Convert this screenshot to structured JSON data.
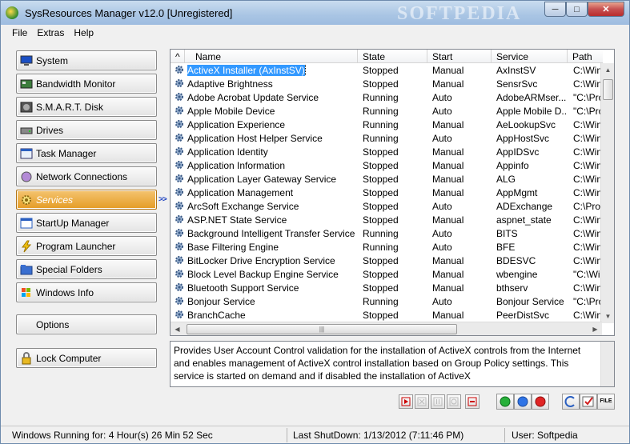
{
  "window": {
    "title": "SysResources Manager  v12.0 [Unregistered]",
    "watermark": "SOFTPEDIA",
    "controls": [
      "minimize",
      "maximize",
      "close"
    ]
  },
  "menu": [
    "File",
    "Extras",
    "Help"
  ],
  "sidebar": {
    "items": [
      {
        "label": "System",
        "icon": "monitor-icon"
      },
      {
        "label": "Bandwidth Monitor",
        "icon": "network-card-icon"
      },
      {
        "label": "S.M.A.R.T. Disk",
        "icon": "disk-icon"
      },
      {
        "label": "Drives",
        "icon": "drive-icon"
      },
      {
        "label": "Task Manager",
        "icon": "task-icon"
      },
      {
        "label": "Network Connections",
        "icon": "globe-icon"
      },
      {
        "label": "Services",
        "icon": "gear-icon",
        "active": true
      },
      {
        "label": "StartUp Manager",
        "icon": "startup-icon"
      },
      {
        "label": "Program Launcher",
        "icon": "lightning-icon"
      },
      {
        "label": "Special Folders",
        "icon": "folder-icon"
      },
      {
        "label": "Windows Info",
        "icon": "windows-logo-icon"
      }
    ],
    "options_label": "Options",
    "lock_label": "Lock Computer",
    "active_arrow": ">>"
  },
  "table": {
    "columns": [
      "Name",
      "State",
      "Start",
      "Service",
      "Path"
    ],
    "sort_indicator": "^",
    "rows": [
      {
        "name": "ActiveX Installer (AxInstSV)",
        "state": "Stopped",
        "start": "Manual",
        "service": "AxInstSV",
        "path": "C:\\Wind",
        "selected": true
      },
      {
        "name": "Adaptive Brightness",
        "state": "Stopped",
        "start": "Manual",
        "service": "SensrSvc",
        "path": "C:\\Wind"
      },
      {
        "name": "Adobe Acrobat Update Service",
        "state": "Running",
        "start": "Auto",
        "service": "AdobeARMser...",
        "path": "\"C:\\Prog"
      },
      {
        "name": "Apple Mobile Device",
        "state": "Running",
        "start": "Auto",
        "service": "Apple Mobile D...",
        "path": "\"C:\\Prog"
      },
      {
        "name": "Application Experience",
        "state": "Running",
        "start": "Manual",
        "service": "AeLookupSvc",
        "path": "C:\\Wind"
      },
      {
        "name": "Application Host Helper Service",
        "state": "Running",
        "start": "Auto",
        "service": "AppHostSvc",
        "path": "C:\\Wind"
      },
      {
        "name": "Application Identity",
        "state": "Stopped",
        "start": "Manual",
        "service": "AppIDSvc",
        "path": "C:\\Wind"
      },
      {
        "name": "Application Information",
        "state": "Stopped",
        "start": "Manual",
        "service": "Appinfo",
        "path": "C:\\Wind"
      },
      {
        "name": "Application Layer Gateway Service",
        "state": "Stopped",
        "start": "Manual",
        "service": "ALG",
        "path": "C:\\Wind"
      },
      {
        "name": "Application Management",
        "state": "Stopped",
        "start": "Manual",
        "service": "AppMgmt",
        "path": "C:\\Wind"
      },
      {
        "name": "ArcSoft Exchange Service",
        "state": "Stopped",
        "start": "Auto",
        "service": "ADExchange",
        "path": "C:\\Prog"
      },
      {
        "name": "ASP.NET State Service",
        "state": "Stopped",
        "start": "Manual",
        "service": "aspnet_state",
        "path": "C:\\Wind"
      },
      {
        "name": "Background Intelligent Transfer Service",
        "state": "Running",
        "start": "Auto",
        "service": "BITS",
        "path": "C:\\Wind"
      },
      {
        "name": "Base Filtering Engine",
        "state": "Running",
        "start": "Auto",
        "service": "BFE",
        "path": "C:\\Wind"
      },
      {
        "name": "BitLocker Drive Encryption Service",
        "state": "Stopped",
        "start": "Manual",
        "service": "BDESVC",
        "path": "C:\\Wind"
      },
      {
        "name": "Block Level Backup Engine Service",
        "state": "Stopped",
        "start": "Manual",
        "service": "wbengine",
        "path": "\"C:\\Wind"
      },
      {
        "name": "Bluetooth Support Service",
        "state": "Stopped",
        "start": "Manual",
        "service": "bthserv",
        "path": "C:\\Wind"
      },
      {
        "name": "Bonjour Service",
        "state": "Running",
        "start": "Auto",
        "service": "Bonjour Service",
        "path": "\"C:\\Prog"
      },
      {
        "name": "BranchCache",
        "state": "Stopped",
        "start": "Manual",
        "service": "PeerDistSvc",
        "path": "C:\\Wind"
      }
    ]
  },
  "description": "Provides User Account Control validation for the installation of ActiveX controls from the Internet and enables management of ActiveX control installation based on Group Policy settings. This service is started on demand and if disabled the installation of ActiveX",
  "toolbar": {
    "buttons": [
      "start-button",
      "stop-button",
      "pause-button",
      "restart-button",
      "delete-button",
      "green-filter-button",
      "blue-filter-button",
      "red-filter-button",
      "refresh-button",
      "check-button",
      "export-file-button"
    ],
    "file_label": "FILE",
    "colors": {
      "green": "#27b03a",
      "blue": "#2f74e6",
      "red": "#e02424"
    }
  },
  "status": {
    "uptime": "Windows Running for: 4 Hour(s) 26 Min 52 Sec",
    "last_shutdown": "Last ShutDown: 1/13/2012 (7:11:46 PM)",
    "user": "User: Softpedia"
  },
  "colors": {
    "selection": "#3399ff",
    "active_nav": "#e59c25"
  }
}
